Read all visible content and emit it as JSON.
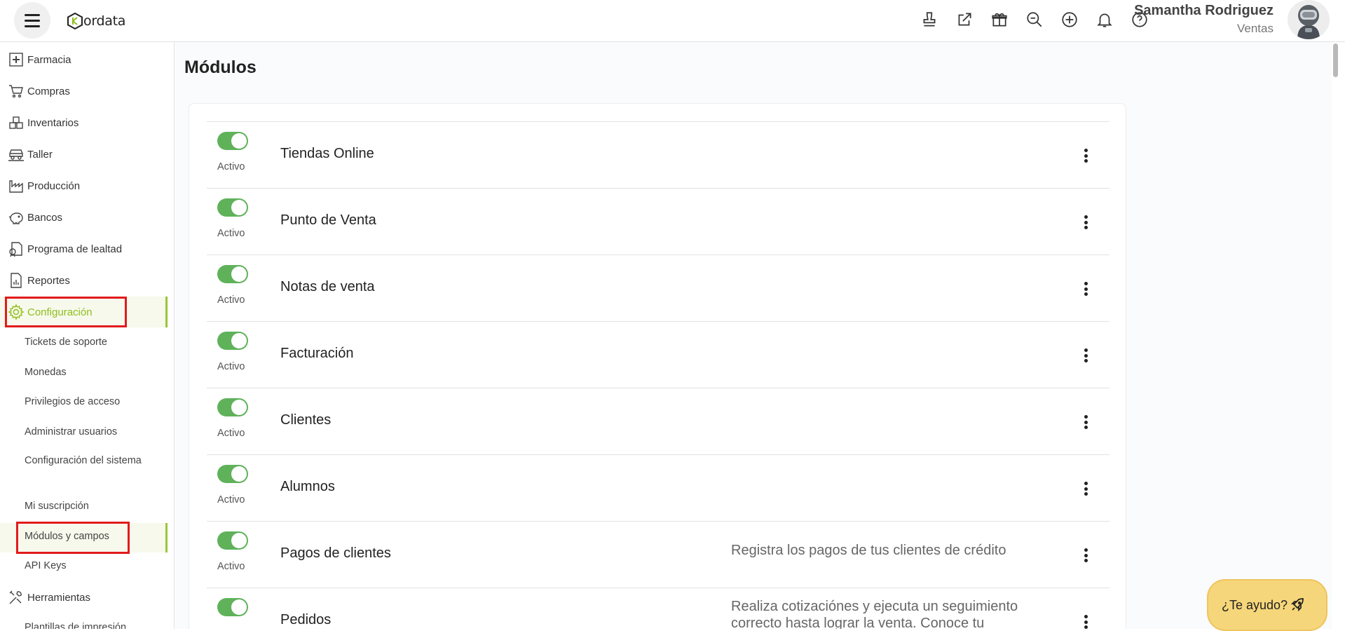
{
  "header": {
    "logo_text": "ordata",
    "user_name": "Samantha Rodriguez",
    "user_role": "Ventas",
    "icons": [
      "stamp-icon",
      "external-link-icon",
      "gift-icon",
      "search-zoom-icon",
      "add-circle-icon",
      "bell-icon",
      "help-circle-icon"
    ]
  },
  "sidebar": {
    "items": [
      {
        "label": "Farmacia",
        "icon": "pharmacy-icon"
      },
      {
        "label": "Compras",
        "icon": "cart-icon"
      },
      {
        "label": "Inventarios",
        "icon": "boxes-icon"
      },
      {
        "label": "Taller",
        "icon": "car-icon"
      },
      {
        "label": "Producción",
        "icon": "factory-icon"
      },
      {
        "label": "Bancos",
        "icon": "piggy-bank-icon"
      },
      {
        "label": "Programa de lealtad",
        "icon": "loyalty-icon"
      },
      {
        "label": "Reportes",
        "icon": "report-icon"
      },
      {
        "label": "Configuración",
        "icon": "gear-icon"
      }
    ],
    "sub_items": [
      "Tickets de soporte",
      "Monedas",
      "Privilegios de acceso",
      "Administrar usuarios",
      "Configuración del sistema",
      "Mi suscripción",
      "Módulos y campos",
      "API Keys"
    ],
    "tools_label": "Herramientas",
    "cut_item": "Plantillas de impresión"
  },
  "main": {
    "title": "Módulos",
    "modules": [
      {
        "name": "Tiendas Online",
        "status": "Activo",
        "description": ""
      },
      {
        "name": "Punto de Venta",
        "status": "Activo",
        "description": ""
      },
      {
        "name": "Notas de venta",
        "status": "Activo",
        "description": ""
      },
      {
        "name": "Facturación",
        "status": "Activo",
        "description": ""
      },
      {
        "name": "Clientes",
        "status": "Activo",
        "description": ""
      },
      {
        "name": "Alumnos",
        "status": "Activo",
        "description": ""
      },
      {
        "name": "Pagos de clientes",
        "status": "Activo",
        "description": "Registra los pagos de tus clientes de crédito"
      },
      {
        "name": "Pedidos",
        "status": "",
        "description": "Realiza cotizaciónes y ejecuta un seguimiento correcto hasta lograr la venta. Conoce tu"
      }
    ]
  },
  "help_button": {
    "label": "¿Te ayudo?",
    "icon": "rocket-icon"
  },
  "colors": {
    "accent_green": "#8fbe1b",
    "toggle_green": "#5fb25a",
    "highlight_red": "#e11b1b",
    "help_yellow": "#f6d67a"
  }
}
